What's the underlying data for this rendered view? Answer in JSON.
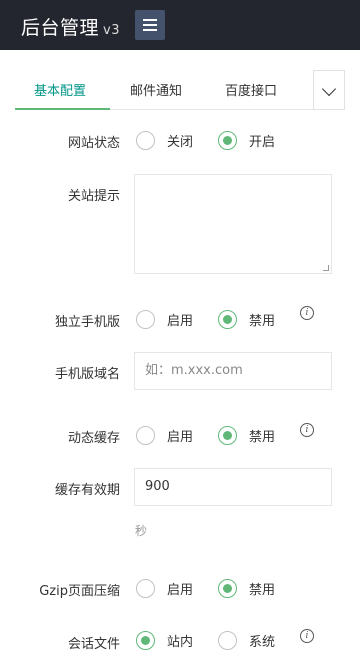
{
  "header": {
    "title": "后台管理",
    "version": "v3",
    "menu_icon": "hamburger-icon"
  },
  "tabs": [
    {
      "label": "基本配置",
      "active": true
    },
    {
      "label": "邮件通知",
      "active": false
    },
    {
      "label": "百度接口",
      "active": false
    }
  ],
  "form": {
    "site_status": {
      "label": "网站状态",
      "options": [
        {
          "label": "关闭",
          "checked": false
        },
        {
          "label": "开启",
          "checked": true
        }
      ]
    },
    "close_notice": {
      "label": "关站提示",
      "value": ""
    },
    "mobile_site": {
      "label": "独立手机版",
      "options": [
        {
          "label": "启用",
          "checked": false
        },
        {
          "label": "禁用",
          "checked": true
        }
      ]
    },
    "mobile_domain": {
      "label": "手机版域名",
      "placeholder": "如：m.xxx.com"
    },
    "dynamic_cache": {
      "label": "动态缓存",
      "options": [
        {
          "label": "启用",
          "checked": false
        },
        {
          "label": "禁用",
          "checked": true
        }
      ]
    },
    "cache_ttl": {
      "label": "缓存有效期",
      "value": "900",
      "unit": "秒"
    },
    "gzip": {
      "label": "Gzip页面压缩",
      "options": [
        {
          "label": "启用",
          "checked": false
        },
        {
          "label": "禁用",
          "checked": true
        }
      ]
    },
    "session_file": {
      "label": "会话文件",
      "options": [
        {
          "label": "站内",
          "checked": true
        },
        {
          "label": "系统",
          "checked": false
        }
      ]
    }
  },
  "colors": {
    "topbar": "#23262e",
    "accent": "#5fb878",
    "active_tab": "#009688"
  }
}
